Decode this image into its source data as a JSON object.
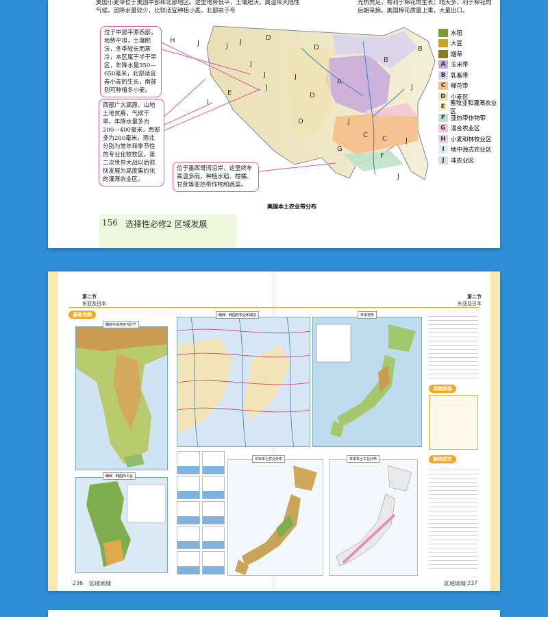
{
  "top_page": {
    "text_left": "美国小麦带位于美国中部和北部地区。这里地势低平，土壤肥沃，属温带大陆性气候。因降水量较少，比较适宜种植小麦。北部由于冬",
    "text_right": "光热充足，有利于棉花的生长；晴天多，利于棉花的后期采摘。美国棉花质量上乘，大量出口。",
    "callouts": {
      "c1": "位于中部平原西部，地势平坦，土壤肥沃，冬季较长而寒冷，本区属于半干旱区，年降水量350—650毫米，北部适宜春小麦的生长，南部则可种植冬小麦。",
      "c2": "西部广大高原、山地土地贫瘠，气候干旱，年降水量多为200—400毫米。西部多为200毫米，南北分别为常年和季节性的专业化牧牧区，第二次世界大战以后很快发展为高度集约化的灌溉农业区。",
      "c3": "位于墨西哥湾沿岸，这里终年高温多雨，种植水稻、柑橘、甘蔗等亚热带作物和蔬菜。"
    },
    "legend": [
      {
        "code": "",
        "label": "水稻",
        "color": "#7a9b2e",
        "icon": "rice-icon"
      },
      {
        "code": "",
        "label": "大豆",
        "color": "#c9a227",
        "icon": "soybean-icon"
      },
      {
        "code": "",
        "label": "烟草",
        "color": "#8a7a2a",
        "icon": "tobacco-icon"
      },
      {
        "code": "A",
        "label": "玉米带",
        "color": "#c7a8dc",
        "icon": ""
      },
      {
        "code": "B",
        "label": "乳畜带",
        "color": "#d8d2f0",
        "icon": ""
      },
      {
        "code": "C",
        "label": "棉花带",
        "color": "#f6bf8a",
        "icon": ""
      },
      {
        "code": "D",
        "label": "小麦区",
        "color": "#f0e2b0",
        "icon": ""
      },
      {
        "code": "E",
        "label": "畜牧业和灌溉农业区",
        "color": "#f8f0c8",
        "icon": ""
      },
      {
        "code": "F",
        "label": "亚热带作物带",
        "color": "#bfe3c8",
        "icon": ""
      },
      {
        "code": "G",
        "label": "混合农业区",
        "color": "#f3c6d6",
        "icon": ""
      },
      {
        "code": "H",
        "label": "小麦和林牧业区",
        "color": "#e8d0e8",
        "icon": ""
      },
      {
        "code": "I",
        "label": "地中海式农业区",
        "color": "#d6eef6",
        "icon": ""
      },
      {
        "code": "J",
        "label": "非农业区",
        "color": "#dcdcdc",
        "icon": ""
      }
    ],
    "map_letters": [
      "H",
      "J",
      "J",
      "J",
      "D",
      "D",
      "B",
      "A",
      "J",
      "J",
      "J",
      "E",
      "I",
      "D",
      "J",
      "D",
      "G",
      "C",
      "J",
      "B",
      "J",
      "J",
      "C",
      "F",
      "J"
    ],
    "caption": "美国本土农业带分布",
    "page_number": "156",
    "footer_text": "选择性必修2 区域发展"
  },
  "bottom_page": {
    "left_header": "第二节",
    "left_header_sub": "东亚及日本",
    "right_header": "第二节",
    "right_header_sub": "东亚及日本",
    "section_tag_left": "基础地图",
    "map1_title": "朝鲜半岛地形与矿产",
    "map2_title": "朝鲜、韩国的农业和湖泊",
    "map3_title": "日本地形",
    "map4_title": "朝鲜、韩国的工业",
    "map5_title": "日本本土农业分布",
    "map6_title": "日本本土工业分布",
    "section_tag_right1": "读图指南",
    "section_tag_right2": "案例探究",
    "left_page_number": "236",
    "left_footer": "区域地理",
    "right_footer": "区域地理",
    "right_page_number": "237"
  }
}
